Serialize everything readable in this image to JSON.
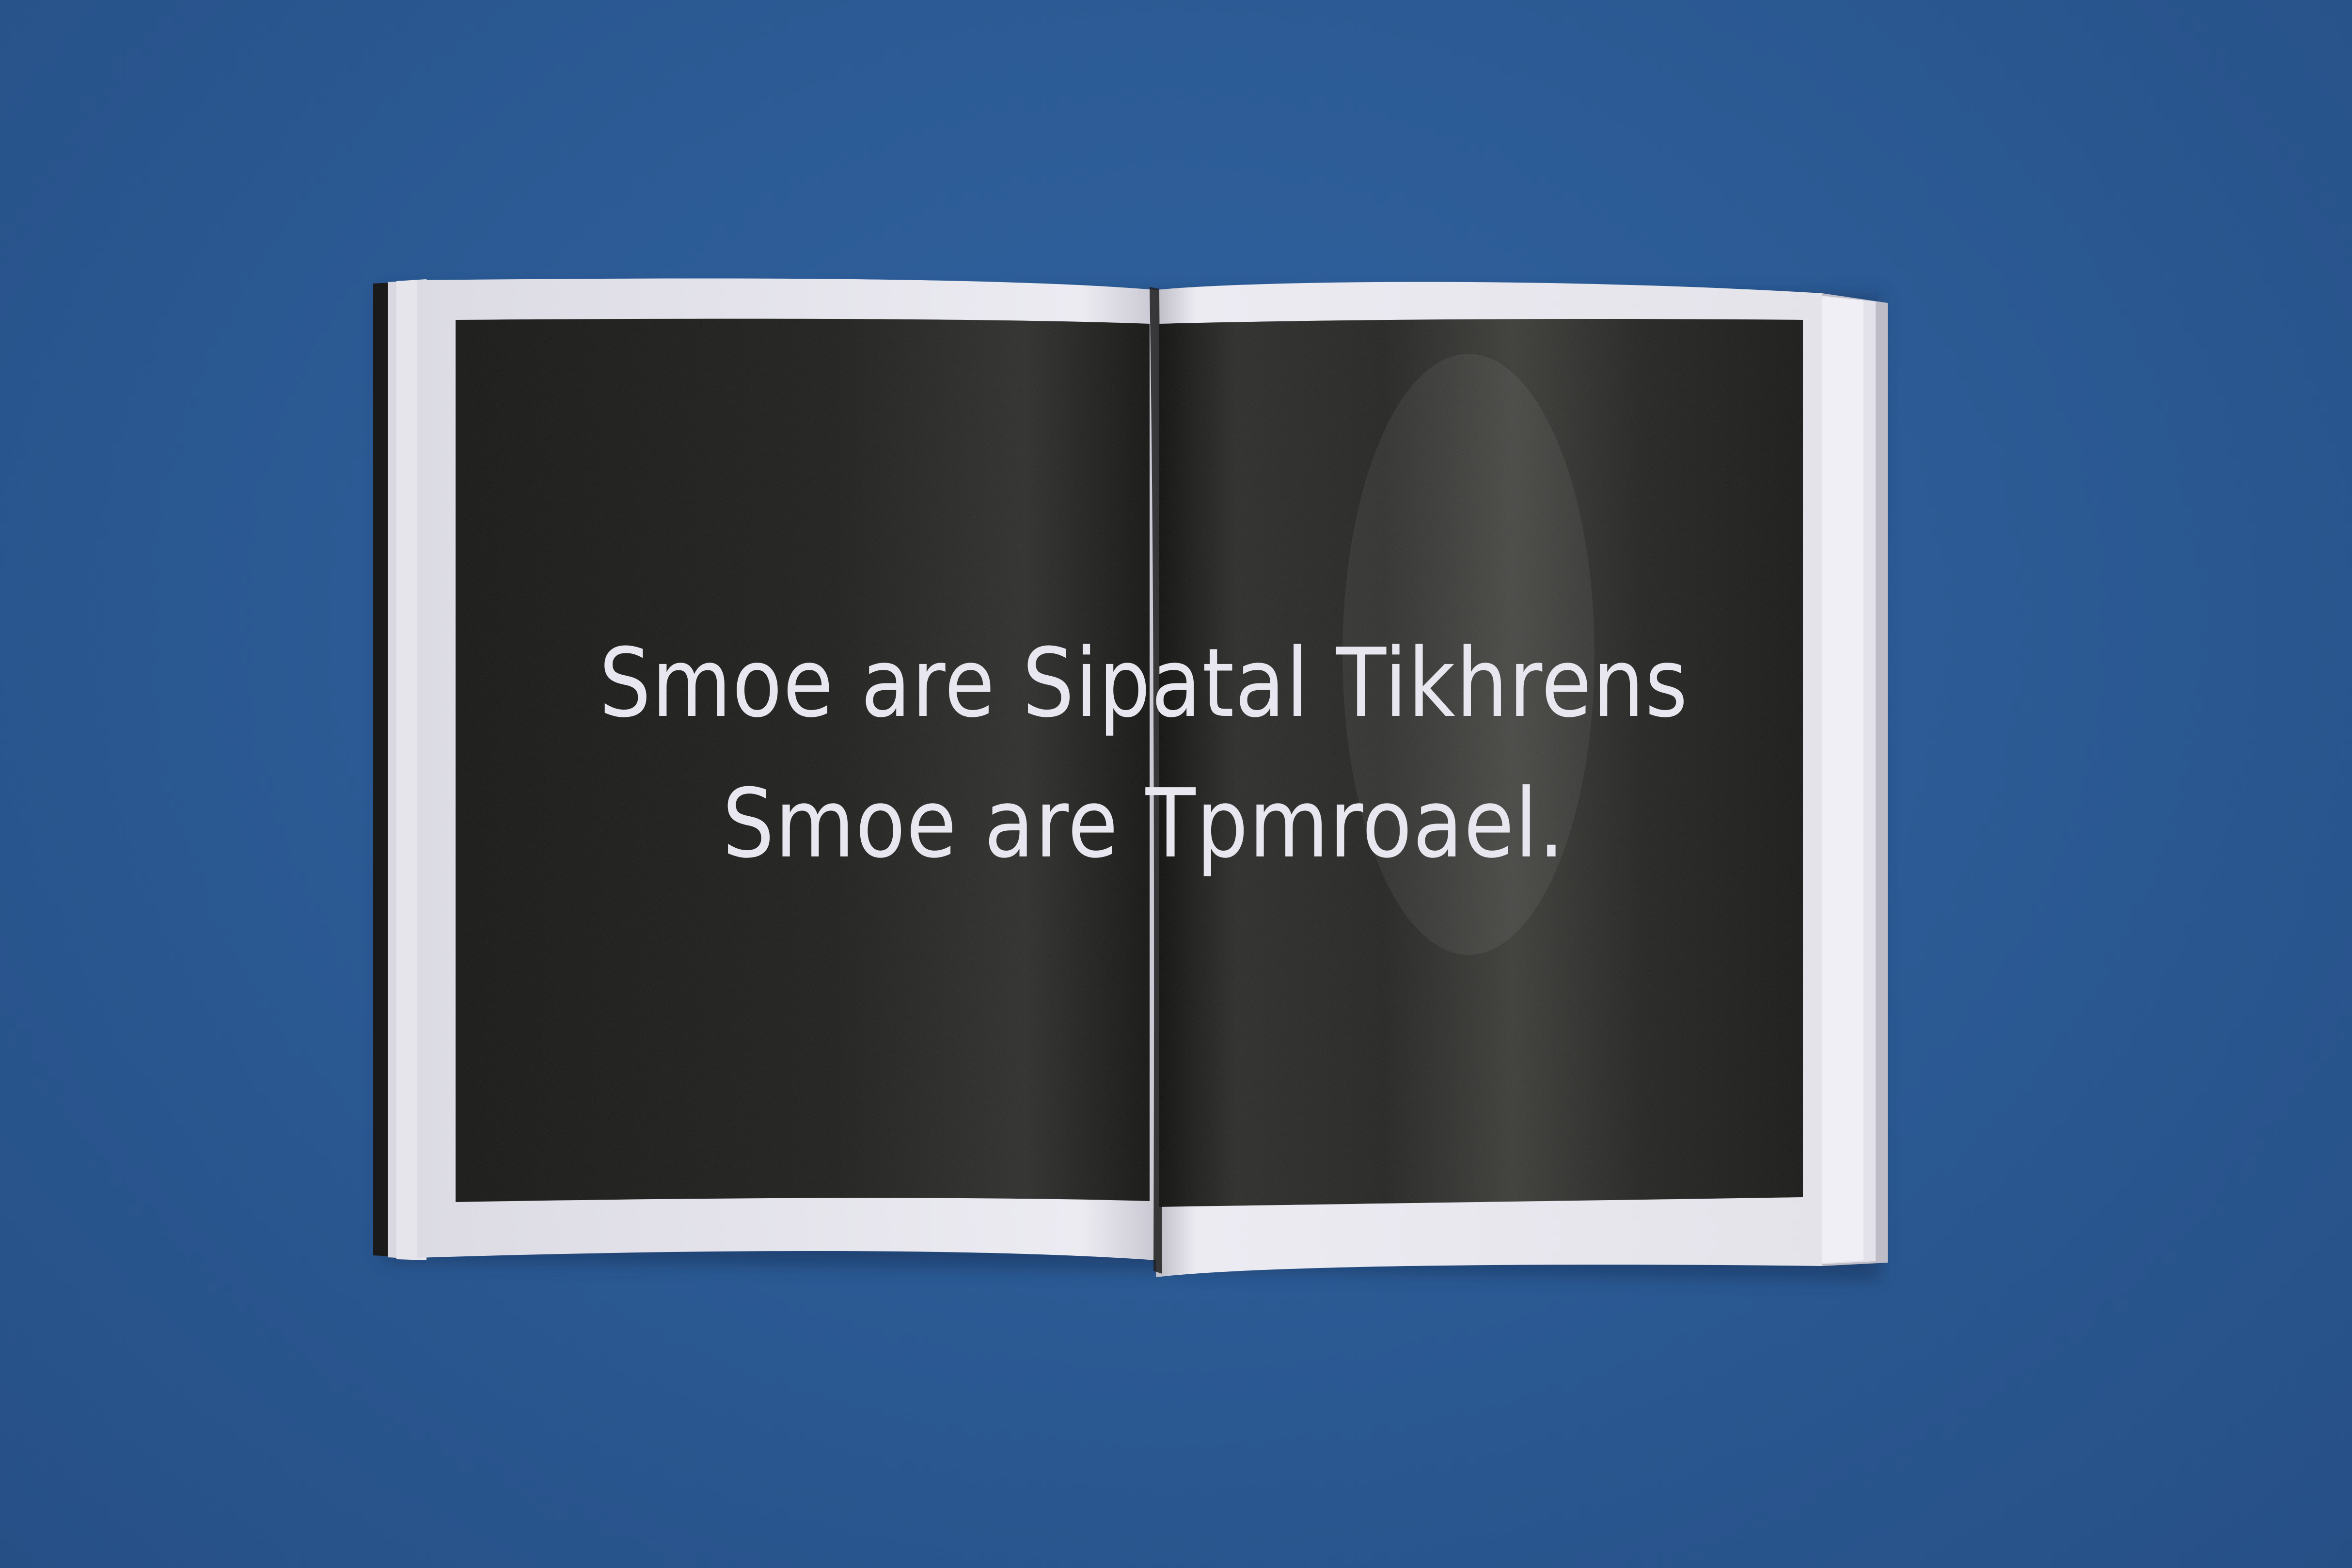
{
  "scene": {
    "background_color": "#2b5892",
    "page_color": "#e9e9f0",
    "print_color": "#1c1c1b"
  },
  "spread": {
    "headline_line_1": "Smoe are Sipatal Tikhrens",
    "headline_line_2": "Smoe are Tpmroael."
  }
}
